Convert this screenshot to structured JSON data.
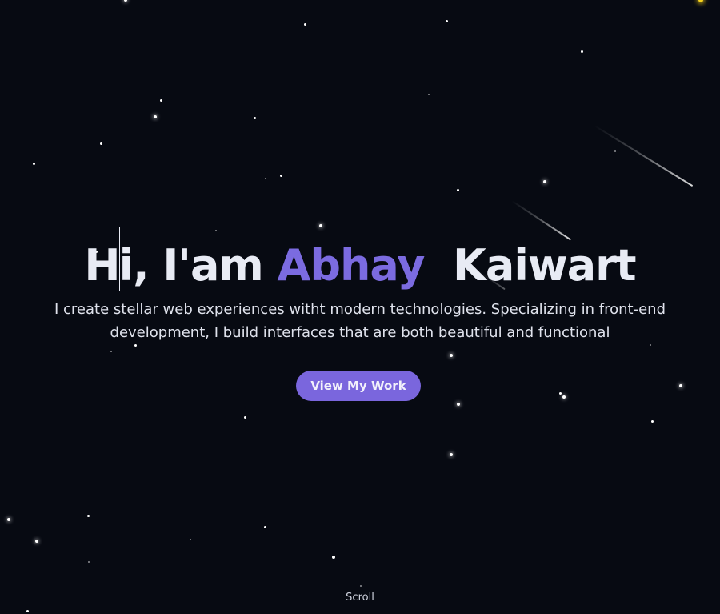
{
  "hero": {
    "greeting_before_cursor": "H",
    "greeting_after_cursor": "i, I'am ",
    "first_name": "Abhay",
    "last_name": "Kaiwart",
    "subtitle": "I create stellar web experiences witht modern technologies. Specializing in front-end development, I build interfaces that are both beautiful and functional",
    "cta_label": "View My Work"
  },
  "scroll_hint": "Scroll",
  "colors": {
    "background": "#070a12",
    "heading_text": "#e8ebf4",
    "accent": "#7b6be0",
    "button": "#7a66dd",
    "corner_spark": "#f7d21b"
  }
}
